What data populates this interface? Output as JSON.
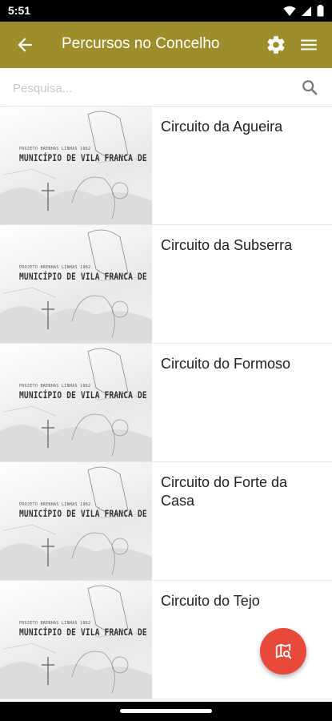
{
  "status_bar": {
    "time": "5:51"
  },
  "app_bar": {
    "title": "Percursos no Concelho",
    "icons": [
      "arrow-back-icon",
      "gear-icon",
      "hamburger-menu-icon"
    ]
  },
  "search": {
    "placeholder": "Pesquisa...",
    "value": ""
  },
  "thumbnail": {
    "caption_small": "PROJETO BRENHAS LINHAS 1962",
    "caption_big": "MUNICÍPIO DE VILA FRANCA DE XIRA"
  },
  "routes": [
    {
      "name": "Circuito da Agueira"
    },
    {
      "name": "Circuito da Subserra"
    },
    {
      "name": "Circuito do Formoso"
    },
    {
      "name": "Circuito do Forte da Casa"
    },
    {
      "name": "Circuito do Tejo"
    }
  ],
  "colors": {
    "app_bar": "#9d8e2b",
    "fab": "#e8493a",
    "status_bar": "#000000"
  },
  "fab": {
    "icon": "map-search-icon"
  }
}
